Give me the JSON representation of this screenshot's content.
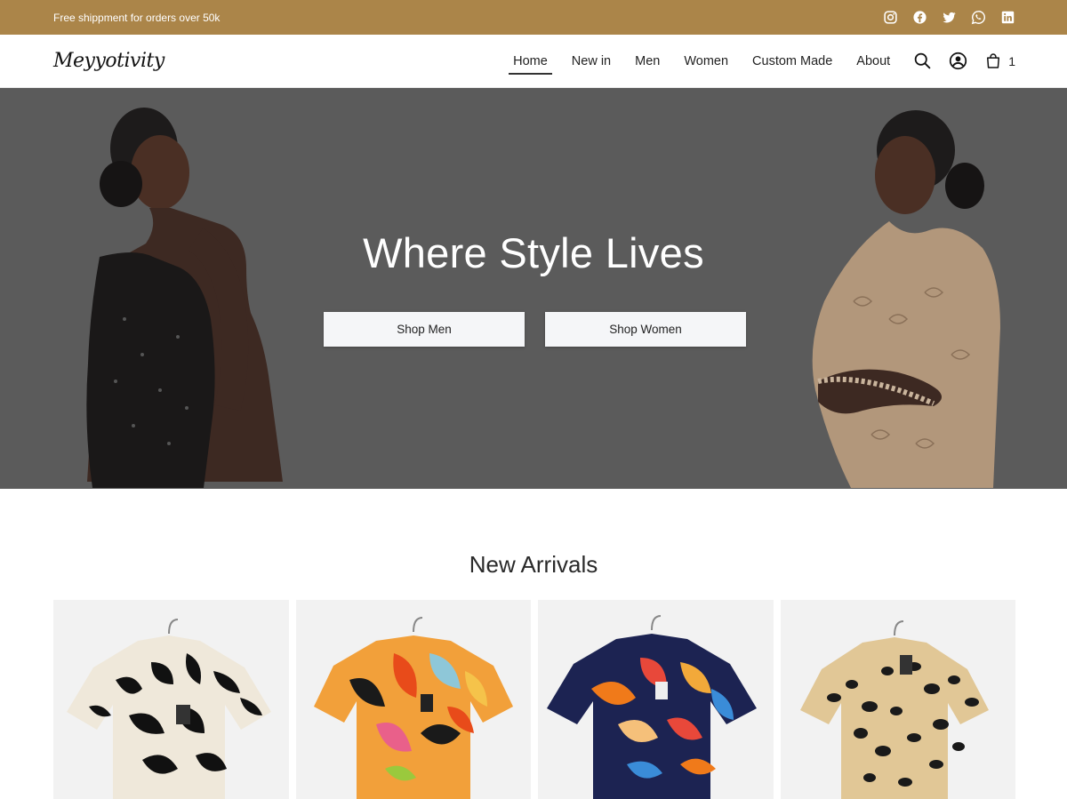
{
  "topbar": {
    "promo": "Free shippment for orders over 50k",
    "social": [
      "instagram-icon",
      "facebook-icon",
      "twitter-icon",
      "whatsapp-icon",
      "linkedin-icon"
    ],
    "color": "#ab8549"
  },
  "header": {
    "logo": "Meyyotivity",
    "nav": [
      {
        "label": "Home",
        "active": true
      },
      {
        "label": "New in",
        "active": false
      },
      {
        "label": "Men",
        "active": false
      },
      {
        "label": "Women",
        "active": false
      },
      {
        "label": "Custom Made",
        "active": false
      },
      {
        "label": "About",
        "active": false
      }
    ],
    "icons": [
      "search-icon",
      "account-icon",
      "cart-icon"
    ],
    "cart_count": "1"
  },
  "hero": {
    "title": "Where Style Lives",
    "shop_men": "Shop Men",
    "shop_women": "Shop Women",
    "overlay_color": "#5b5b5b"
  },
  "new_arrivals": {
    "title": "New Arrivals",
    "products": [
      {
        "pattern": "black-white-leaf-print-shirt"
      },
      {
        "pattern": "orange-tropical-print-shirt"
      },
      {
        "pattern": "navy-orange-abstract-print-shirt"
      },
      {
        "pattern": "leopard-print-shirt"
      }
    ]
  }
}
